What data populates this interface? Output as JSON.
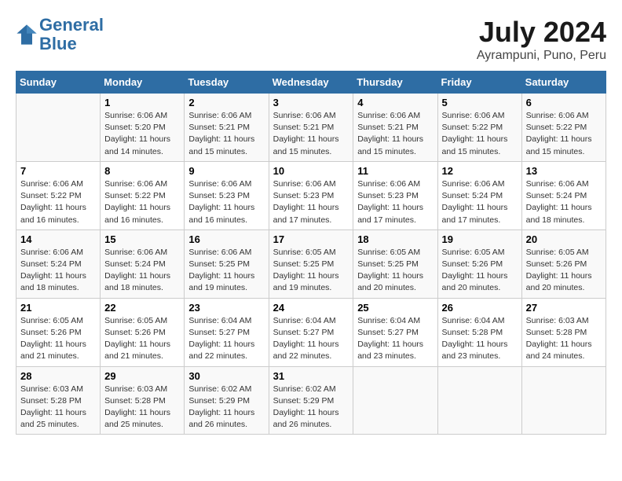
{
  "header": {
    "logo_line1": "General",
    "logo_line2": "Blue",
    "month_year": "July 2024",
    "location": "Ayrampuni, Puno, Peru"
  },
  "days_of_week": [
    "Sunday",
    "Monday",
    "Tuesday",
    "Wednesday",
    "Thursday",
    "Friday",
    "Saturday"
  ],
  "weeks": [
    [
      {
        "num": "",
        "info": ""
      },
      {
        "num": "1",
        "info": "Sunrise: 6:06 AM\nSunset: 5:20 PM\nDaylight: 11 hours\nand 14 minutes."
      },
      {
        "num": "2",
        "info": "Sunrise: 6:06 AM\nSunset: 5:21 PM\nDaylight: 11 hours\nand 15 minutes."
      },
      {
        "num": "3",
        "info": "Sunrise: 6:06 AM\nSunset: 5:21 PM\nDaylight: 11 hours\nand 15 minutes."
      },
      {
        "num": "4",
        "info": "Sunrise: 6:06 AM\nSunset: 5:21 PM\nDaylight: 11 hours\nand 15 minutes."
      },
      {
        "num": "5",
        "info": "Sunrise: 6:06 AM\nSunset: 5:22 PM\nDaylight: 11 hours\nand 15 minutes."
      },
      {
        "num": "6",
        "info": "Sunrise: 6:06 AM\nSunset: 5:22 PM\nDaylight: 11 hours\nand 15 minutes."
      }
    ],
    [
      {
        "num": "7",
        "info": "Sunrise: 6:06 AM\nSunset: 5:22 PM\nDaylight: 11 hours\nand 16 minutes."
      },
      {
        "num": "8",
        "info": "Sunrise: 6:06 AM\nSunset: 5:22 PM\nDaylight: 11 hours\nand 16 minutes."
      },
      {
        "num": "9",
        "info": "Sunrise: 6:06 AM\nSunset: 5:23 PM\nDaylight: 11 hours\nand 16 minutes."
      },
      {
        "num": "10",
        "info": "Sunrise: 6:06 AM\nSunset: 5:23 PM\nDaylight: 11 hours\nand 17 minutes."
      },
      {
        "num": "11",
        "info": "Sunrise: 6:06 AM\nSunset: 5:23 PM\nDaylight: 11 hours\nand 17 minutes."
      },
      {
        "num": "12",
        "info": "Sunrise: 6:06 AM\nSunset: 5:24 PM\nDaylight: 11 hours\nand 17 minutes."
      },
      {
        "num": "13",
        "info": "Sunrise: 6:06 AM\nSunset: 5:24 PM\nDaylight: 11 hours\nand 18 minutes."
      }
    ],
    [
      {
        "num": "14",
        "info": "Sunrise: 6:06 AM\nSunset: 5:24 PM\nDaylight: 11 hours\nand 18 minutes."
      },
      {
        "num": "15",
        "info": "Sunrise: 6:06 AM\nSunset: 5:24 PM\nDaylight: 11 hours\nand 18 minutes."
      },
      {
        "num": "16",
        "info": "Sunrise: 6:06 AM\nSunset: 5:25 PM\nDaylight: 11 hours\nand 19 minutes."
      },
      {
        "num": "17",
        "info": "Sunrise: 6:05 AM\nSunset: 5:25 PM\nDaylight: 11 hours\nand 19 minutes."
      },
      {
        "num": "18",
        "info": "Sunrise: 6:05 AM\nSunset: 5:25 PM\nDaylight: 11 hours\nand 20 minutes."
      },
      {
        "num": "19",
        "info": "Sunrise: 6:05 AM\nSunset: 5:26 PM\nDaylight: 11 hours\nand 20 minutes."
      },
      {
        "num": "20",
        "info": "Sunrise: 6:05 AM\nSunset: 5:26 PM\nDaylight: 11 hours\nand 20 minutes."
      }
    ],
    [
      {
        "num": "21",
        "info": "Sunrise: 6:05 AM\nSunset: 5:26 PM\nDaylight: 11 hours\nand 21 minutes."
      },
      {
        "num": "22",
        "info": "Sunrise: 6:05 AM\nSunset: 5:26 PM\nDaylight: 11 hours\nand 21 minutes."
      },
      {
        "num": "23",
        "info": "Sunrise: 6:04 AM\nSunset: 5:27 PM\nDaylight: 11 hours\nand 22 minutes."
      },
      {
        "num": "24",
        "info": "Sunrise: 6:04 AM\nSunset: 5:27 PM\nDaylight: 11 hours\nand 22 minutes."
      },
      {
        "num": "25",
        "info": "Sunrise: 6:04 AM\nSunset: 5:27 PM\nDaylight: 11 hours\nand 23 minutes."
      },
      {
        "num": "26",
        "info": "Sunrise: 6:04 AM\nSunset: 5:28 PM\nDaylight: 11 hours\nand 23 minutes."
      },
      {
        "num": "27",
        "info": "Sunrise: 6:03 AM\nSunset: 5:28 PM\nDaylight: 11 hours\nand 24 minutes."
      }
    ],
    [
      {
        "num": "28",
        "info": "Sunrise: 6:03 AM\nSunset: 5:28 PM\nDaylight: 11 hours\nand 25 minutes."
      },
      {
        "num": "29",
        "info": "Sunrise: 6:03 AM\nSunset: 5:28 PM\nDaylight: 11 hours\nand 25 minutes."
      },
      {
        "num": "30",
        "info": "Sunrise: 6:02 AM\nSunset: 5:29 PM\nDaylight: 11 hours\nand 26 minutes."
      },
      {
        "num": "31",
        "info": "Sunrise: 6:02 AM\nSunset: 5:29 PM\nDaylight: 11 hours\nand 26 minutes."
      },
      {
        "num": "",
        "info": ""
      },
      {
        "num": "",
        "info": ""
      },
      {
        "num": "",
        "info": ""
      }
    ]
  ]
}
